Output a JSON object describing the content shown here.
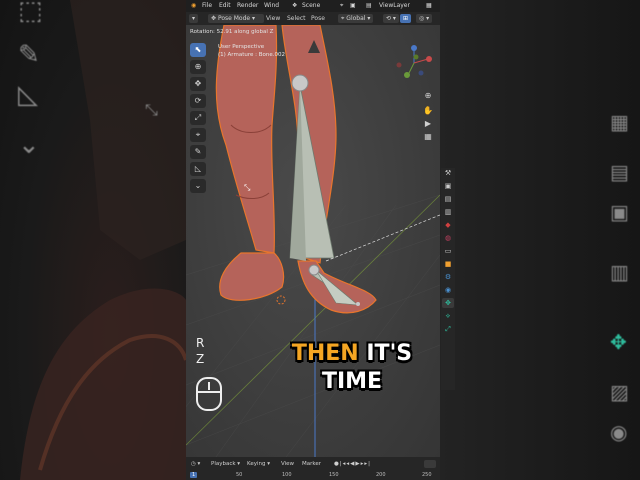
{
  "menubar": {
    "items": [
      "File",
      "Edit",
      "Render",
      "Wind"
    ],
    "scene": "Scene",
    "view_layer": "ViewLayer"
  },
  "header": {
    "mode": "Pose Mode",
    "menus": [
      "View",
      "Select",
      "Pose"
    ],
    "orientation": "Global"
  },
  "viewport": {
    "status": "Rotation: 52.91 along global Z",
    "perspective": "User Perspective",
    "object": "(1) Armature : Bone.002"
  },
  "overlay": {
    "keys": [
      "R",
      "Z"
    ],
    "caption_line1_highlight": "THEN",
    "caption_line1_rest": "IT'S",
    "caption_line2": "TIME"
  },
  "timeline": {
    "menus": [
      "Playback",
      "Keying",
      "View",
      "Marker"
    ],
    "frame": "1",
    "ticks": [
      "50",
      "100",
      "150",
      "200",
      "250"
    ]
  },
  "colors": {
    "accent": "#4772b3",
    "caption_highlight": "#f5a623",
    "model": "#b5635a",
    "outline": "#e8752c"
  }
}
